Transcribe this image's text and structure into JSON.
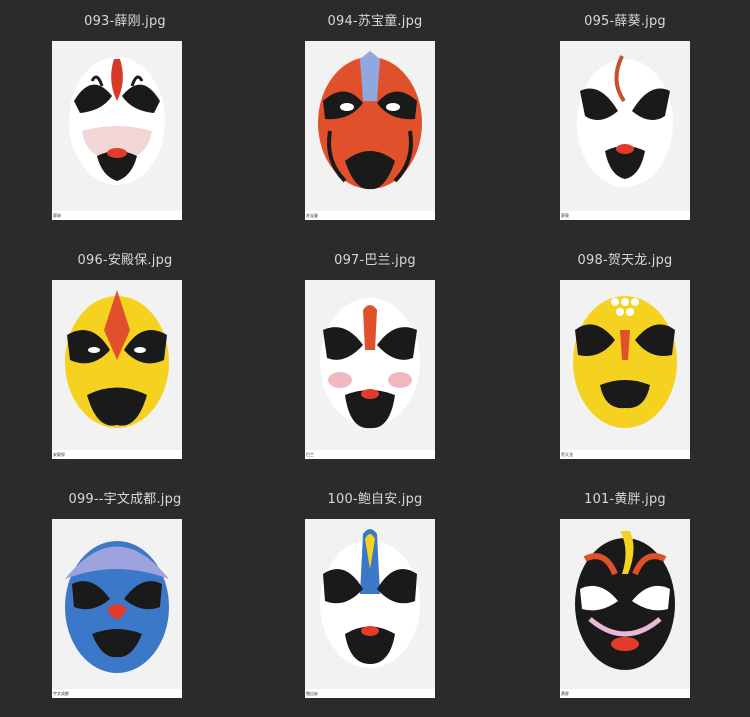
{
  "files": [
    {
      "name": "093-薛刚.jpg",
      "caption": "薛刚",
      "style": "white-red"
    },
    {
      "name": "094-苏宝童.jpg",
      "caption": "苏宝童",
      "style": "orange"
    },
    {
      "name": "095-薛葵.jpg",
      "caption": "薛葵",
      "style": "white-black"
    },
    {
      "name": "096-安殿保.jpg",
      "caption": "安殿保",
      "style": "yellow"
    },
    {
      "name": "097-巴兰.jpg",
      "caption": "巴兰",
      "style": "white-pink"
    },
    {
      "name": "098-贺天龙.jpg",
      "caption": "贺天龙",
      "style": "yellow-dots"
    },
    {
      "name": "099--宇文成都.jpg",
      "caption": "宇文成都",
      "style": "blue"
    },
    {
      "name": "100-鲍自安.jpg",
      "caption": "鲍自安",
      "style": "blue-yellow"
    },
    {
      "name": "101-黄胖.jpg",
      "caption": "黄胖",
      "style": "black-ornate"
    }
  ],
  "colors": {
    "background": "#2b2b2b",
    "label": "#d8d8d8",
    "mask_black": "#1a1a1a",
    "mask_red": "#e23b2a",
    "mask_orange": "#e0502a",
    "mask_yellow": "#f5d21f",
    "mask_blue": "#3c78c8",
    "mask_lavender": "#9ea3e0",
    "mask_pink": "#f0b8c0"
  }
}
